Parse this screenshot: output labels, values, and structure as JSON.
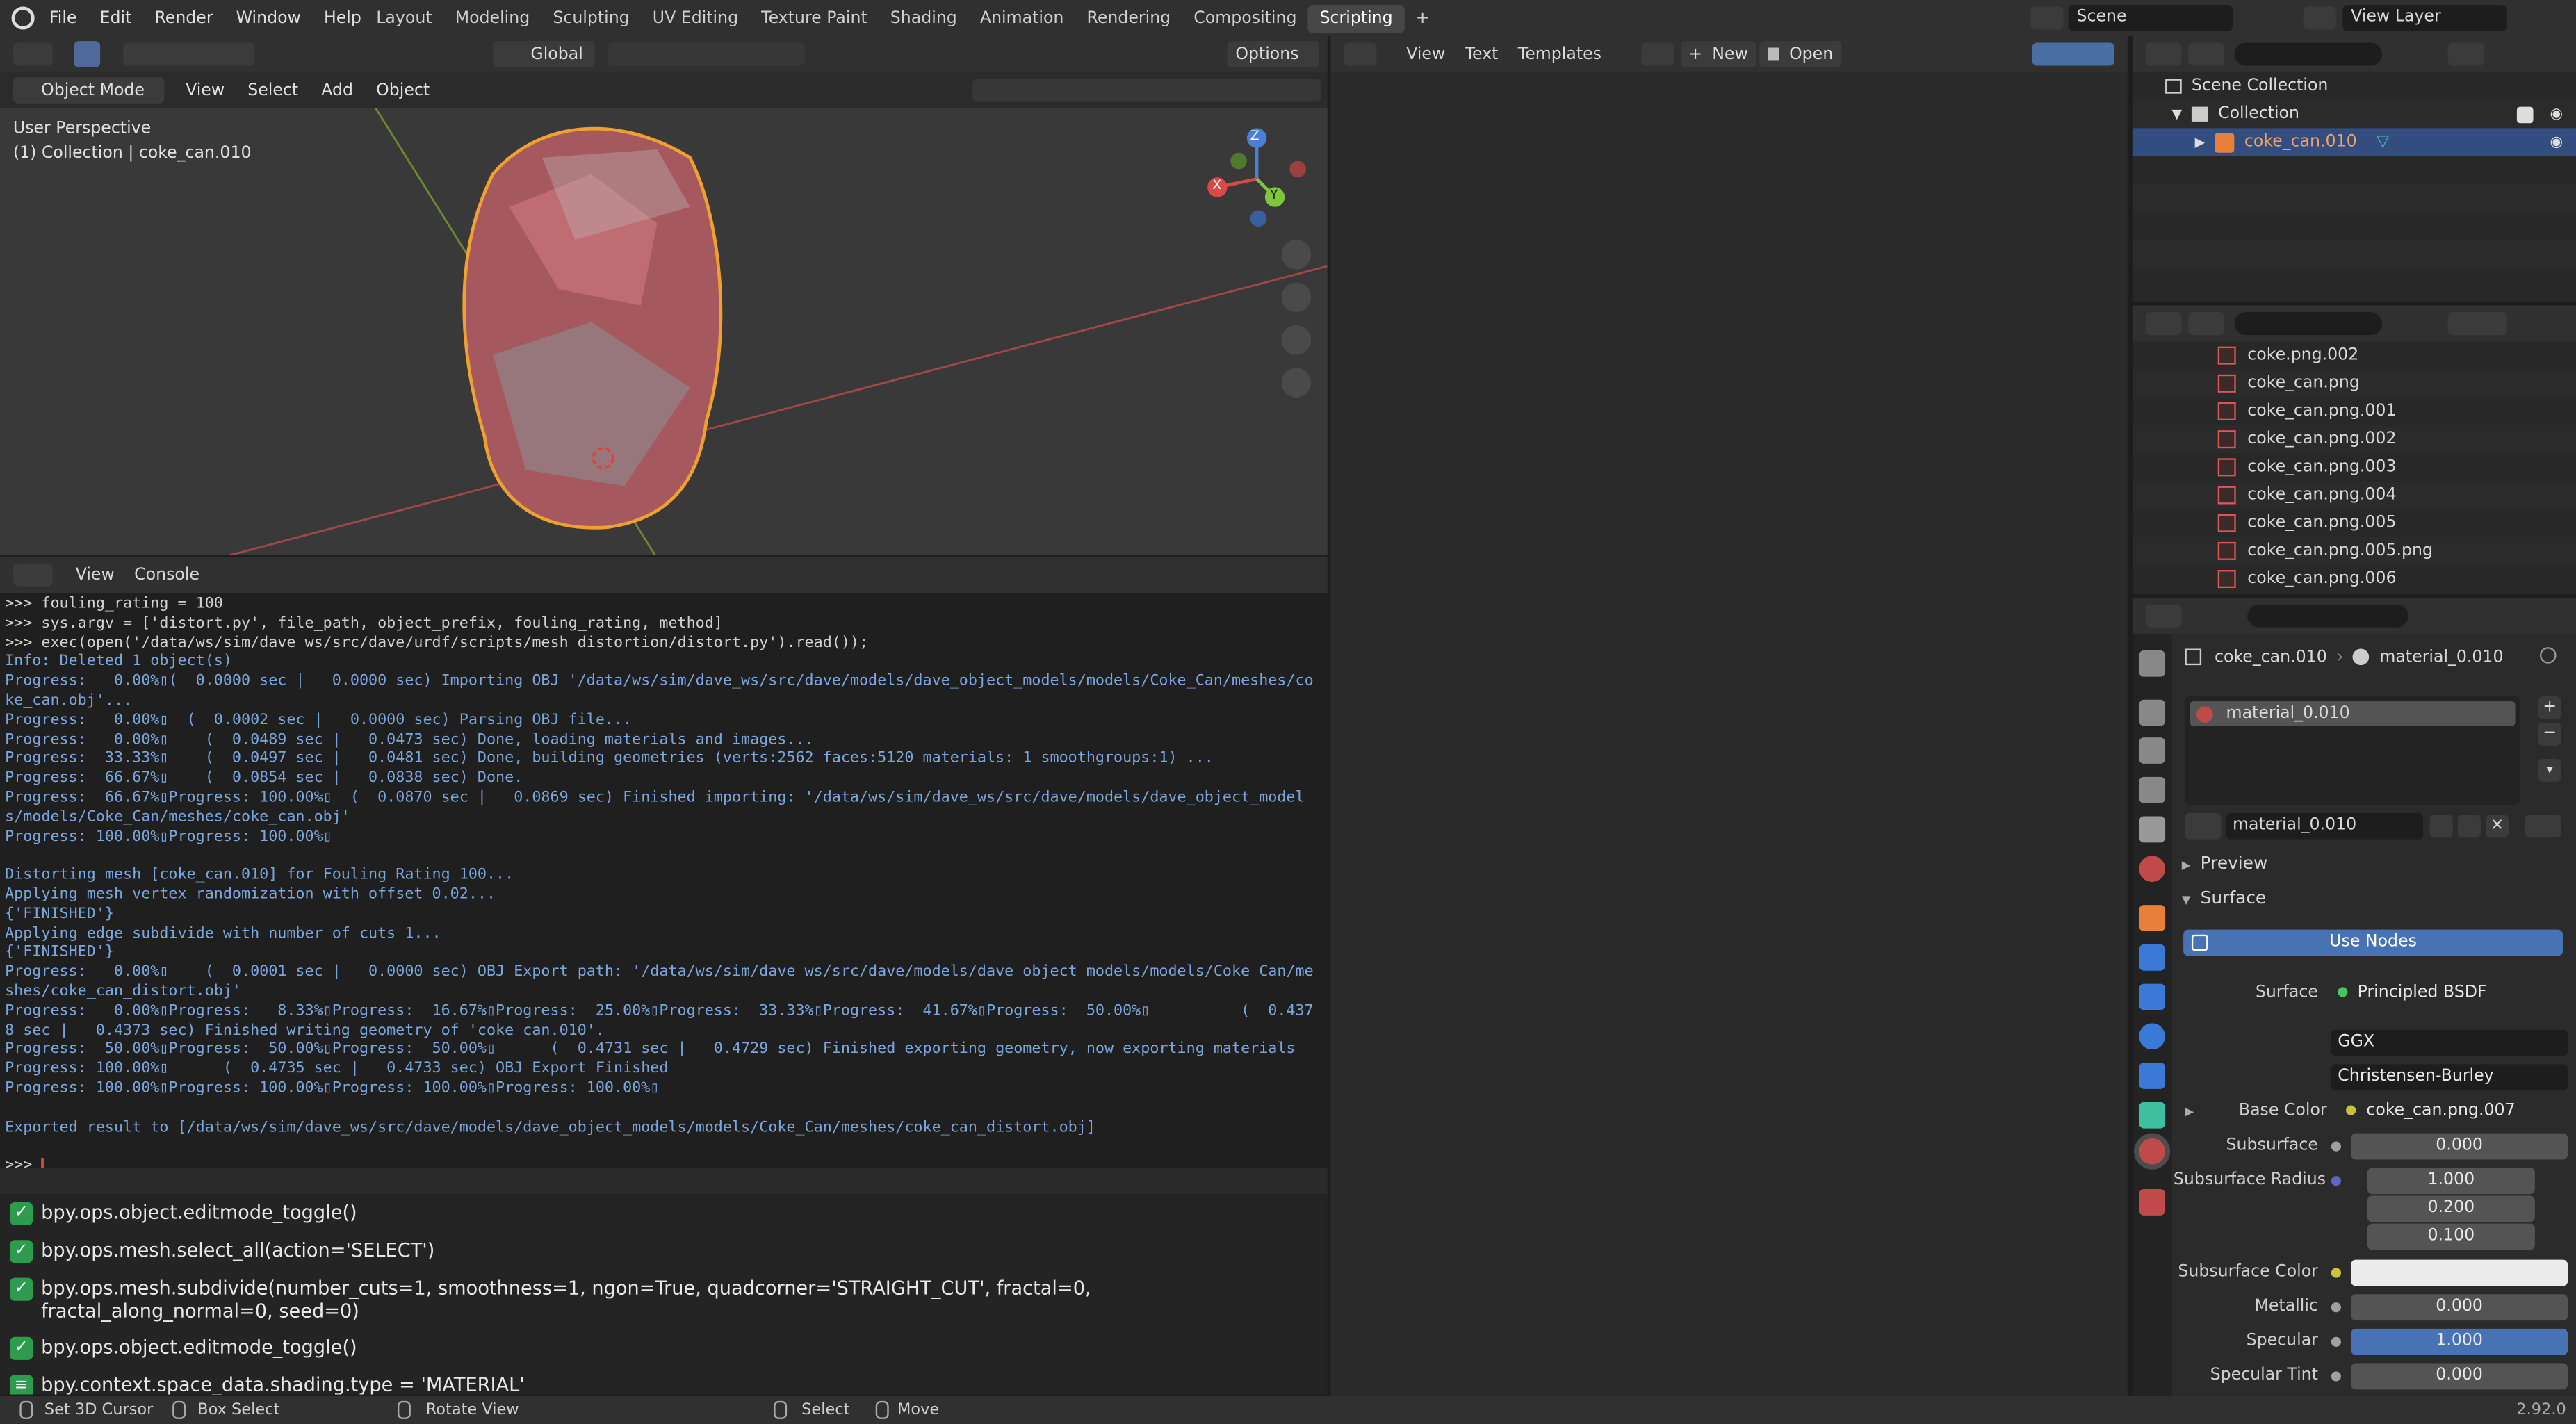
{
  "topbar": {
    "menus": [
      "File",
      "Edit",
      "Render",
      "Window",
      "Help"
    ],
    "workspaces": [
      "Layout",
      "Modeling",
      "Sculpting",
      "UV Editing",
      "Texture Paint",
      "Shading",
      "Animation",
      "Rendering",
      "Compositing",
      "Scripting"
    ],
    "active_workspace": "Scripting",
    "add_tab": "+",
    "scene": "Scene",
    "view_layer": "View Layer"
  },
  "viewport": {
    "toolbar": {
      "transform": "Global",
      "options": "Options"
    },
    "header": {
      "mode": "Object Mode",
      "menus": [
        "View",
        "Select",
        "Add",
        "Object"
      ]
    },
    "overlay_title": "User Perspective",
    "overlay_sub": "(1) Collection | coke_can.010",
    "gizmo": {
      "z": "Z",
      "x": "X",
      "y": "Y"
    }
  },
  "text_editor": {
    "menus": [
      "View",
      "Text",
      "Templates"
    ],
    "new": "New",
    "open": "Open"
  },
  "console": {
    "menus": [
      "View",
      "Console"
    ],
    "lines": [
      {
        "t": "cl",
        "s": ">>> fouling_rating = 100"
      },
      {
        "t": "cl",
        "s": ">>> sys.argv = ['distort.py', file_path, object_prefix, fouling_rating, method]"
      },
      {
        "t": "cl",
        "s": ">>> exec(open('/data/ws/sim/dave_ws/src/dave/urdf/scripts/mesh_distortion/distort.py').read());"
      },
      {
        "t": "out",
        "s": "Info: Deleted 1 object(s)"
      },
      {
        "t": "out",
        "s": "Progress:   0.00%\u0000(  0.0000 sec |   0.0000 sec) Importing OBJ '/data/ws/sim/dave_ws/src/dave/models/dave_object_models/models/Coke_Can/meshes/coke_can.obj'..."
      },
      {
        "t": "out",
        "s": "Progress:   0.00%\u0000  (  0.0002 sec |   0.0000 sec) Parsing OBJ file..."
      },
      {
        "t": "out",
        "s": "Progress:   0.00%\u0000    (  0.0489 sec |   0.0473 sec) Done, loading materials and images..."
      },
      {
        "t": "out",
        "s": "Progress:  33.33%\u0000    (  0.0497 sec |   0.0481 sec) Done, building geometries (verts:2562 faces:5120 materials: 1 smoothgroups:1) ..."
      },
      {
        "t": "out",
        "s": "Progress:  66.67%\u0000    (  0.0854 sec |   0.0838 sec) Done."
      },
      {
        "t": "out",
        "s": "Progress:  66.67%\u0000Progress: 100.00%\u0000  (  0.0870 sec |   0.0869 sec) Finished importing: '/data/ws/sim/dave_ws/src/dave/models/dave_object_models/models/Coke_Can/meshes/coke_can.obj'"
      },
      {
        "t": "out",
        "s": "Progress: 100.00%\u0000Progress: 100.00%\u0000"
      },
      {
        "t": "out",
        "s": " "
      },
      {
        "t": "out",
        "s": "Distorting mesh [coke_can.010] for Fouling Rating 100..."
      },
      {
        "t": "out",
        "s": "Applying mesh vertex randomization with offset 0.02..."
      },
      {
        "t": "out",
        "s": "{'FINISHED'}"
      },
      {
        "t": "out",
        "s": "Applying edge subdivide with number of cuts 1..."
      },
      {
        "t": "out",
        "s": "{'FINISHED'}"
      },
      {
        "t": "out",
        "s": "Progress:   0.00%\u0000    (  0.0001 sec |   0.0000 sec) OBJ Export path: '/data/ws/sim/dave_ws/src/dave/models/dave_object_models/models/Coke_Can/meshes/coke_can_distort.obj'"
      },
      {
        "t": "out",
        "s": "Progress:   0.00%\u0000Progress:   8.33%\u0000Progress:  16.67%\u0000Progress:  25.00%\u0000Progress:  33.33%\u0000Progress:  41.67%\u0000Progress:  50.00%\u0000          (  0.4378 sec |   0.4373 sec) Finished writing geometry of 'coke_can.010'."
      },
      {
        "t": "out",
        "s": "Progress:  50.00%\u0000Progress:  50.00%\u0000Progress:  50.00%\u0000      (  0.4731 sec |   0.4729 sec) Finished exporting geometry, now exporting materials"
      },
      {
        "t": "out",
        "s": "Progress: 100.00%\u0000      (  0.4735 sec |   0.4733 sec) OBJ Export Finished"
      },
      {
        "t": "out",
        "s": "Progress: 100.00%\u0000Progress: 100.00%\u0000Progress: 100.00%\u0000Progress: 100.00%\u0000"
      },
      {
        "t": "out",
        "s": " "
      },
      {
        "t": "out",
        "s": "Exported result to [/data/ws/sim/dave_ws/src/dave/models/dave_object_models/models/Coke_Can/meshes/coke_can_distort.obj]"
      },
      {
        "t": "out",
        "s": " "
      },
      {
        "t": "cl",
        "s": ">>> "
      }
    ]
  },
  "info_log": [
    {
      "icon": "check",
      "text": "bpy.ops.object.editmode_toggle()"
    },
    {
      "icon": "check",
      "text": "bpy.ops.mesh.select_all(action='SELECT')"
    },
    {
      "icon": "check",
      "text": "bpy.ops.mesh.subdivide(number_cuts=1, smoothness=1, ngon=True, quadcorner='STRAIGHT_CUT', fractal=0, fractal_along_normal=0, seed=0)"
    },
    {
      "icon": "check",
      "text": "bpy.ops.object.editmode_toggle()"
    },
    {
      "icon": "prop",
      "text": "bpy.context.space_data.shading.type = 'MATERIAL'"
    }
  ],
  "outliner": {
    "root": "Scene Collection",
    "collection": "Collection",
    "object": "coke_can.010"
  },
  "file_browser": {
    "items": [
      "coke.png.002",
      "coke_can.png",
      "coke_can.png.001",
      "coke_can.png.002",
      "coke_can.png.003",
      "coke_can.png.004",
      "coke_can.png.005",
      "coke_can.png.005.png",
      "coke_can.png.006"
    ]
  },
  "properties": {
    "breadcrumb_object": "coke_can.010",
    "breadcrumb_material": "material_0.010",
    "slot": "material_0.010",
    "material_name": "material_0.010",
    "preview": "Preview",
    "surface_section": "Surface",
    "use_nodes": "Use Nodes",
    "surface_label": "Surface",
    "surface_value": "Principled BSDF",
    "distribution": "GGX",
    "sss_method": "Christensen-Burley",
    "base_color_label": "Base Color",
    "base_color_value": "coke_can.png.007",
    "subsurface_label": "Subsurface",
    "subsurface_value": "0.000",
    "subsurface_radius_label": "Subsurface Radius",
    "subsurface_radius": [
      "1.000",
      "0.200",
      "0.100"
    ],
    "subsurface_color_label": "Subsurface Color",
    "metallic_label": "Metallic",
    "metallic_value": "0.000",
    "specular_label": "Specular",
    "specular_value": "1.000",
    "specular_tint_label": "Specular Tint",
    "specular_tint_value": "0.000"
  },
  "statusbar": {
    "items": [
      "Set 3D Cursor",
      "Box Select",
      "Rotate View",
      "Select",
      "Move"
    ],
    "version": "2.92.0"
  }
}
